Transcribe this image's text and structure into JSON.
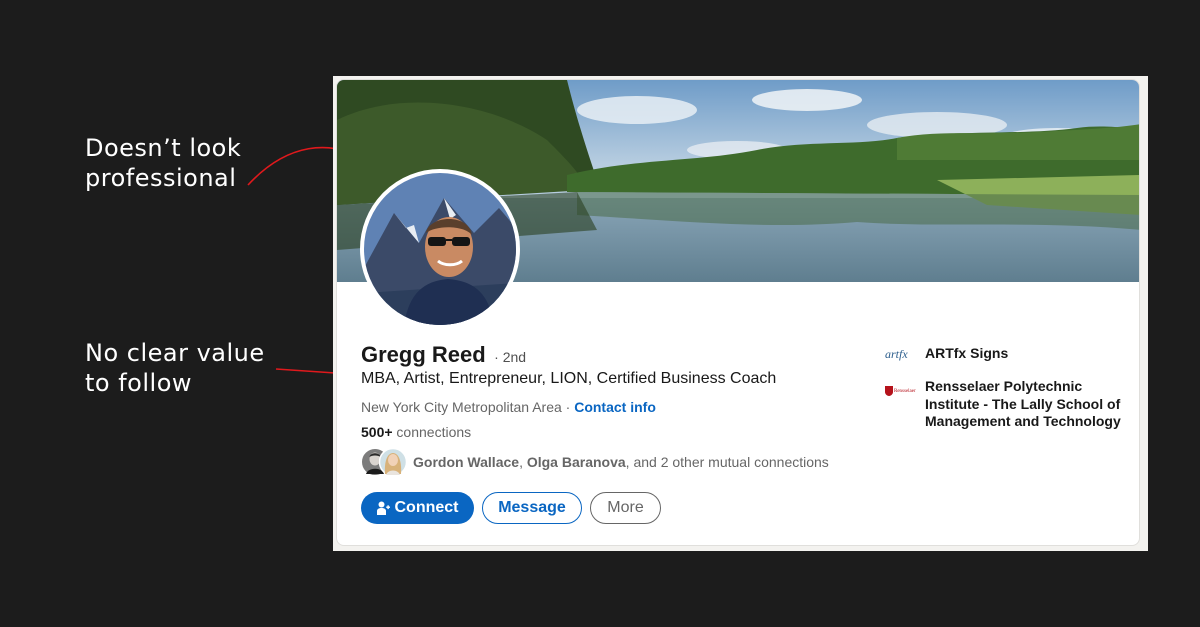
{
  "annotations": [
    {
      "text": "Doesn’t look professional"
    },
    {
      "text": "No clear value to follow"
    }
  ],
  "profile": {
    "name": "Gregg Reed",
    "degree": "· 2nd",
    "headline": "MBA, Artist, Entrepreneur, LION, Certified Business Coach",
    "location": "New York City Metropolitan Area · ",
    "contact_link": "Contact info",
    "connections_count": "500+",
    "connections_suffix": " connections",
    "mutual": {
      "name1": "Gordon Wallace",
      "sep": ", ",
      "name2": "Olga Baranova",
      "rest": ", and 2 other mutual connections"
    }
  },
  "actions": {
    "connect": "Connect",
    "message": "Message",
    "more": "More"
  },
  "experience": [
    {
      "logo_text": "artfx",
      "name": "ARTfx Signs"
    },
    {
      "logo_text": "Rensselaer",
      "name": "Rensselaer Polytechnic Institute - The Lally School of Management and Technology"
    }
  ],
  "colors": {
    "background": "#1c1c1c",
    "link_blue": "#0a66c2",
    "arrow_red": "#e0191c"
  },
  "icons": [
    "add-person-icon"
  ]
}
